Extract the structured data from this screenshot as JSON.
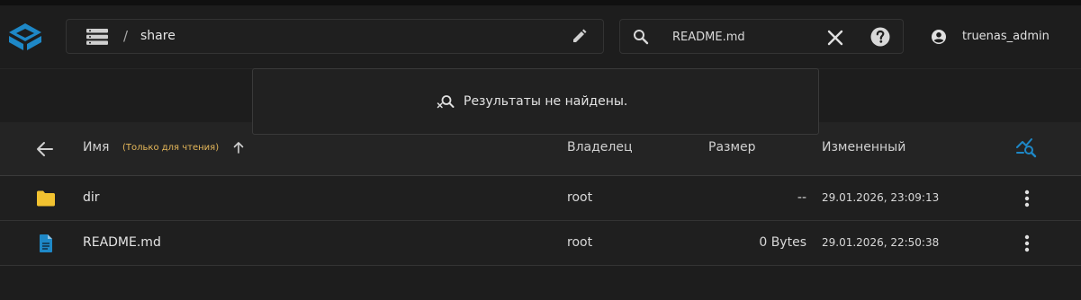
{
  "header": {
    "path": {
      "separator": "/",
      "segment": "share"
    },
    "search": {
      "value": "README.md",
      "placeholder": ""
    },
    "user": {
      "name": "truenas_admin"
    }
  },
  "search_popup": {
    "message": "Результаты не найдены."
  },
  "table": {
    "columns": {
      "name": "Имя",
      "name_badge": "(Только для чтения)",
      "owner": "Владелец",
      "size": "Размер",
      "modified": "Измененный"
    },
    "rows": [
      {
        "name": "dir",
        "owner": "root",
        "size": "--",
        "modified": "29.01.2026, 23:09:13",
        "icon": "folder-icon"
      },
      {
        "name": "README.md",
        "owner": "root",
        "size": "0 Bytes",
        "modified": "29.01.2026, 22:50:38",
        "icon": "file-document-icon"
      }
    ]
  },
  "colors": {
    "accent": "#1e88c7",
    "folder": "#f2c230",
    "readonly": "#e6b85a",
    "background": "#1d1d1d"
  }
}
